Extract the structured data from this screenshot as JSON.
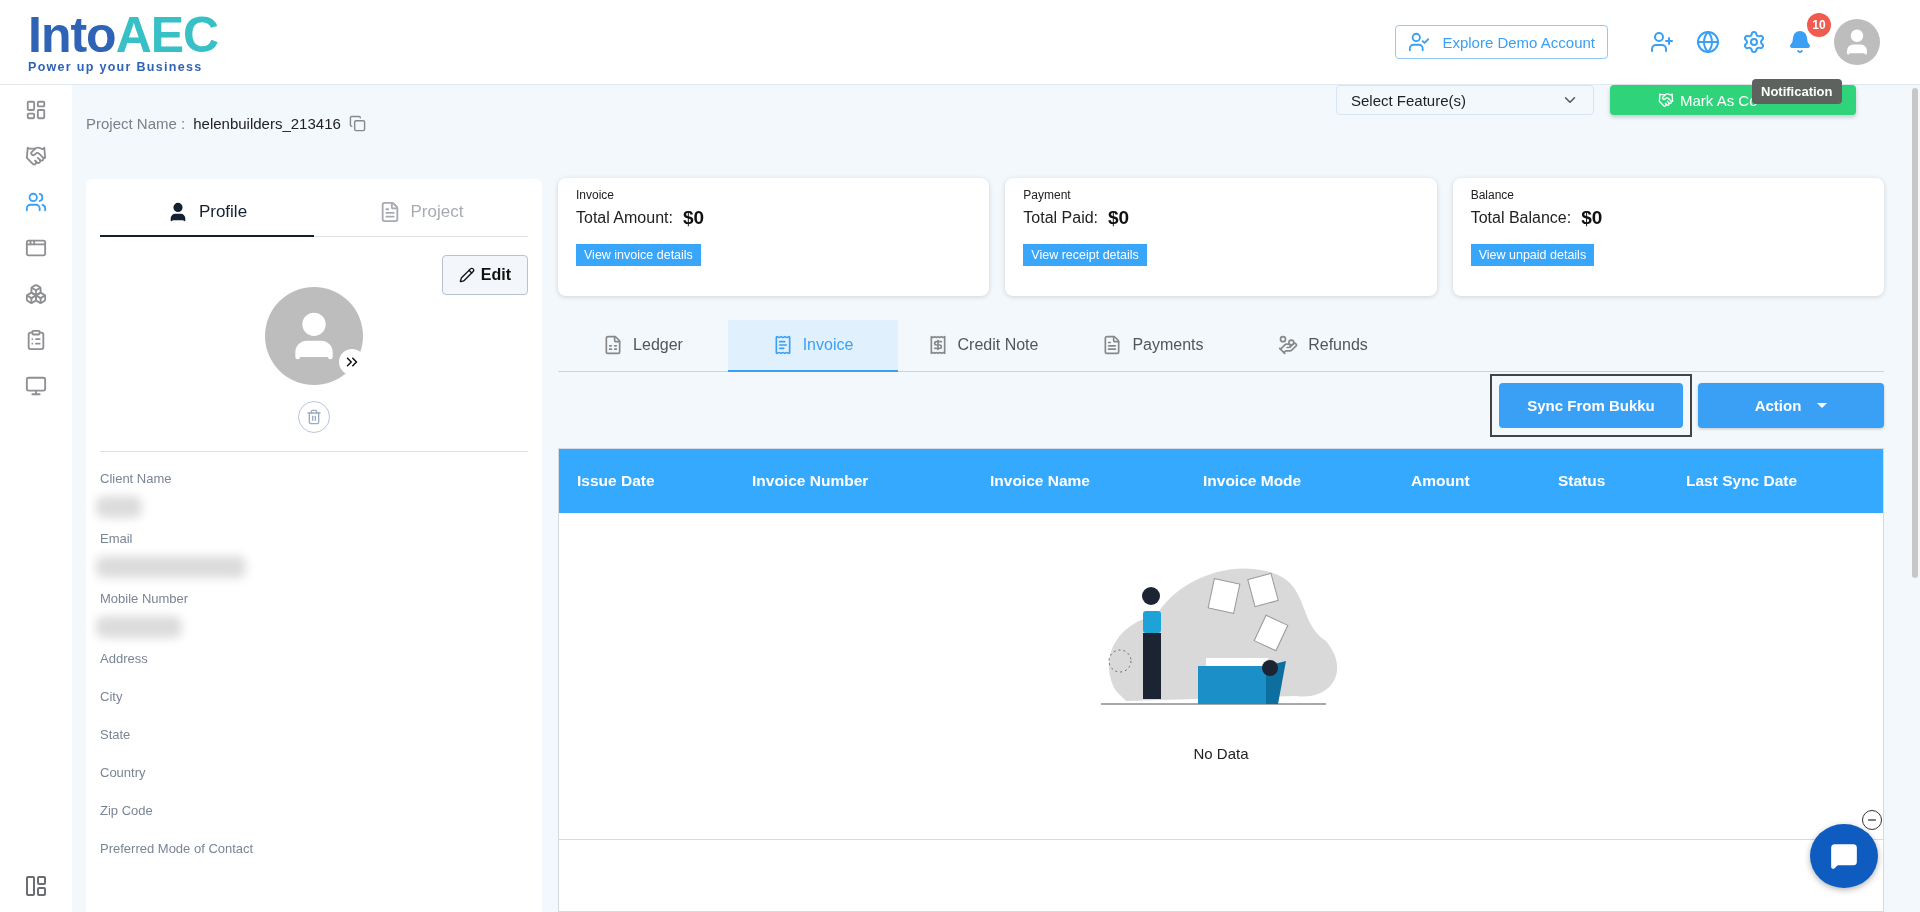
{
  "header": {
    "logo": {
      "word": "Into",
      "accent": "AEC",
      "tagline": "Power up your Business"
    },
    "explore_button": "Explore Demo Account",
    "notification_count": "10",
    "tooltip": "Notification"
  },
  "sidebar": {
    "items": [
      {
        "selected": false
      },
      {
        "selected": false
      },
      {
        "selected": true
      },
      {
        "selected": false
      },
      {
        "selected": false
      },
      {
        "selected": false
      },
      {
        "selected": false
      }
    ]
  },
  "project": {
    "label": "Project Name :",
    "value": "helenbuilders_213416"
  },
  "feature_select": {
    "placeholder": "Select Feature(s)"
  },
  "mark_button": "Mark As Co",
  "profile_panel": {
    "tabs": [
      {
        "label": "Profile",
        "selected": true
      },
      {
        "label": "Project",
        "selected": false
      }
    ],
    "edit_button": "Edit",
    "fields": [
      {
        "label": "Client Name",
        "redacted": true
      },
      {
        "label": "Email",
        "redacted": true
      },
      {
        "label": "Mobile Number",
        "redacted": true
      },
      {
        "label": "Address",
        "redacted": false
      },
      {
        "label": "City",
        "redacted": false
      },
      {
        "label": "State",
        "redacted": false
      },
      {
        "label": "Country",
        "redacted": false
      },
      {
        "label": "Zip Code",
        "redacted": false
      },
      {
        "label": "Preferred Mode of Contact",
        "redacted": false
      }
    ]
  },
  "summary_cards": [
    {
      "title": "Invoice",
      "label": "Total Amount:",
      "value": "$0",
      "link": "View invoice details"
    },
    {
      "title": "Payment",
      "label": "Total Paid:",
      "value": "$0",
      "link": "View receipt details"
    },
    {
      "title": "Balance",
      "label": "Total Balance:",
      "value": "$0",
      "link": "View unpaid details"
    }
  ],
  "ledger_tabs": [
    {
      "label": "Ledger",
      "selected": false
    },
    {
      "label": "Invoice",
      "selected": true
    },
    {
      "label": "Credit Note",
      "selected": false
    },
    {
      "label": "Payments",
      "selected": false
    },
    {
      "label": "Refunds",
      "selected": false
    }
  ],
  "sync_button": {
    "label": "Sync From Bukku",
    "focused": true
  },
  "action_button": "Action",
  "table": {
    "columns": [
      "Issue Date",
      "Invoice Number",
      "Invoice Name",
      "Invoice Mode",
      "Amount",
      "Status",
      "Last Sync Date"
    ],
    "empty_text": "No Data"
  }
}
